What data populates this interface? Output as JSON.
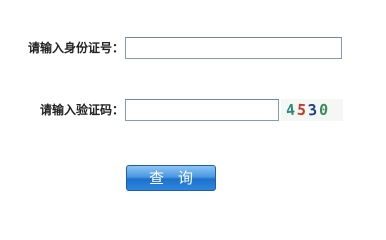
{
  "form": {
    "id_label": "请输入身份证号：",
    "id_value": "",
    "captcha_label": "请输入验证码：",
    "captcha_value": "",
    "captcha_image": {
      "digits": [
        "4",
        "5",
        "3",
        "0"
      ],
      "colors": [
        "#2a8a7a",
        "#c0392b",
        "#1f3f8f",
        "#3a8a5a"
      ]
    },
    "submit_label": "查询"
  }
}
